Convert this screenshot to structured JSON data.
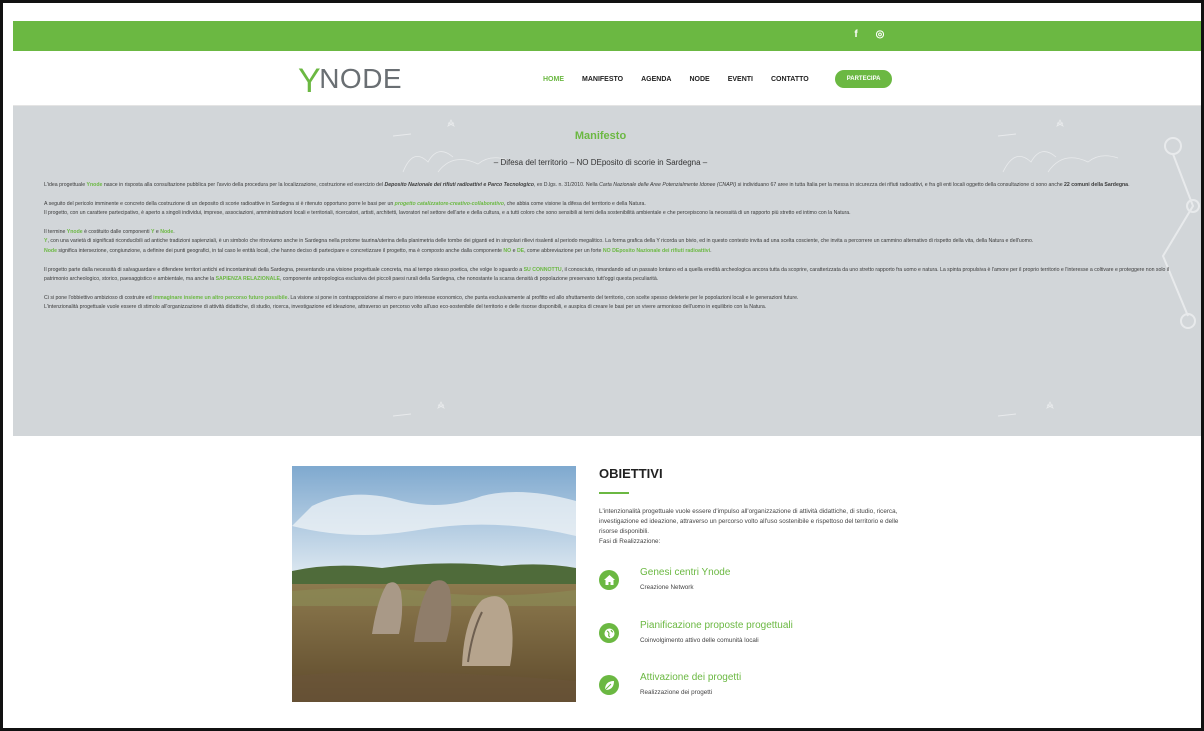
{
  "topbar": {
    "facebook": "f",
    "instagram": "◎"
  },
  "header": {
    "logo_y": "Y",
    "logo_rest": "NODE",
    "nav": [
      "HOME",
      "MANIFESTO",
      "AGENDA",
      "NODE",
      "EVENTI",
      "CONTATTO"
    ],
    "cta": "PARTECIPA"
  },
  "manifesto": {
    "title": "Manifesto",
    "subtitle": "– Difesa del territorio – NO DEposito di scorie in Sardegna –",
    "p1": {
      "a": "L'idea progettuale ",
      "b": "Ynode",
      "c": " nasce in risposta alla consultazione pubblica per l'avvio della procedura per la localizzazione, costruzione ed esercizio del ",
      "d": "Deposito Nazionale dei rifiuti radioattivi e Parco Tecnologico",
      "e": ", ex D.lgs. n. 31/2010. Nella ",
      "f": "Carta Nazionale delle Aree Potenzialmente Idonee (CNAPI)",
      "g": " si individuano 67 aree in tutta Italia per la messa in sicurezza dei rifiuti radioattivi, e fra gli enti locali oggetto della consultazione ci sono anche ",
      "h": "22 comuni della Sardegna",
      "i": "."
    },
    "p2": {
      "a": "A seguito del pericolo imminente e concreto della costruzione di un deposito di scorie radioattive in Sardegna si è ritenuto opportuno porre le basi per un ",
      "b": "progetto catalizzatore-creativo-collaborativo",
      "c": ", che abbia come visione la difesa del territorio e della Natura.",
      "d": "Il progetto, con un carattere partecipativo, è aperto a singoli individui, imprese, associazioni, amministrazioni locali e territoriali, ricercatori, artisti, architetti, lavoratori nel settore dell'arte e della cultura, e a tutti coloro che sono sensibili ai temi della sostenibilità ambientale e che percepiscono la necessità di un rapporto più stretto ed intimo con la Natura."
    },
    "p3": {
      "a": "Il termine ",
      "b": "Ynode",
      "c": " è costituito dalle componenti ",
      "d": "Y",
      "e": " e ",
      "f": "Node",
      "g": ".",
      "h": "Y",
      "i": ", con una varietà di significati riconducibili ad antiche tradizioni sapienziali, è un simbolo che ritroviamo anche in Sardegna nella protome taurina/uterina della planimetria delle tombe dei giganti ed in singolari rilievi risalenti al periodo megalitico. La forma grafica della Y ricorda un bivio, ed in questo contesto invita ad una scelta cosciente, che invita a percorrere un cammino alternativo di rispetto della vita, della Natura e dell'uomo.",
      "j": "Node",
      "k": " significa intersezione, congiunzione, a definire dei punti geografici, in tal caso le entità locali, che hanno deciso di partecipare e concretizzare il progetto, ma è composto anche dalla componente ",
      "l": "NO",
      "m": " e ",
      "n": "DE",
      "o": ", come abbreviazione per un forte ",
      "p": "NO DEposito Nazionale dei rifiuti radioattivi",
      "q": "."
    },
    "p4": {
      "a": "Il progetto parte dalla necessità di salvaguardare e difendere territori antichi ed incontaminati della Sardegna, presentando una visione progettuale concreta, ma al tempo stesso poetica, che volge lo sguardo a ",
      "b": "SU CONNOTTU",
      "c": ", il conosciuto, rimandando ad un passato lontano ed a quella eredità archeologica ancora tutta da scoprire, caratterizzata da uno stretto rapporto fra uomo e natura. La spinta propulsiva è l'amore per il proprio territorio e l'interesse a coltivare e proteggere non solo il patrimonio archeologico, storico, paesaggistico e ambientale, ma anche la ",
      "d": "SAPIENZA RELAZIONALE",
      "e": ", componente antropologica esclusiva dei piccoli paesi rurali della Sardegna, che nonostante la scarsa densità di popolazione preservano tutt'oggi questa peculiarità."
    },
    "p5": {
      "a": "Ci si pone l'obbiettivo ambizioso di costruire ed ",
      "b": "immaginare insieme un altro percorso futuro possibile",
      "c": ". La visione si pone in contrapposizione al mero e puro interesse economico, che punta esclusivamente al profitto ed allo sfruttamento del territorio, con scelte spesso deleterie per le popolazioni locali e le generazioni future.",
      "d": "L'intenzionalità progettuale vuole essere di stimolo all'organizzazione di attività didattiche, di studio, ricerca, investigazione ed ideazione, attraverso un percorso volto all'uso eco-sostenibile del territorio e delle risorse disponibili, e auspica di creare le basi per un vivere armonioso dell'uomo in equilibrio con la Natura."
    }
  },
  "obiettivi": {
    "title": "OBIETTIVI",
    "text": "L'intenzionalità progettuale vuole essere d'impulso all'organizzazione di attività didattiche, di studio, ricerca, investigazione ed ideazione, attraverso un percorso volto all'uso sostenibile e rispettoso del territorio e delle risorse disponibili.",
    "fasi": "Fasi di Realizzazione:",
    "phases": [
      {
        "icon": "home-icon",
        "title": "Genesi centri Ynode",
        "desc": "Creazione Network"
      },
      {
        "icon": "globe-icon",
        "title": "Pianificazione proposte progettuali",
        "desc": "Coinvolgimento attivo delle comunità locali"
      },
      {
        "icon": "leaf-icon",
        "title": "Attivazione dei progetti",
        "desc": "Realizzazione dei progetti"
      }
    ]
  },
  "colors": {
    "accent": "#6bb842",
    "band": "#d2d6d9"
  }
}
